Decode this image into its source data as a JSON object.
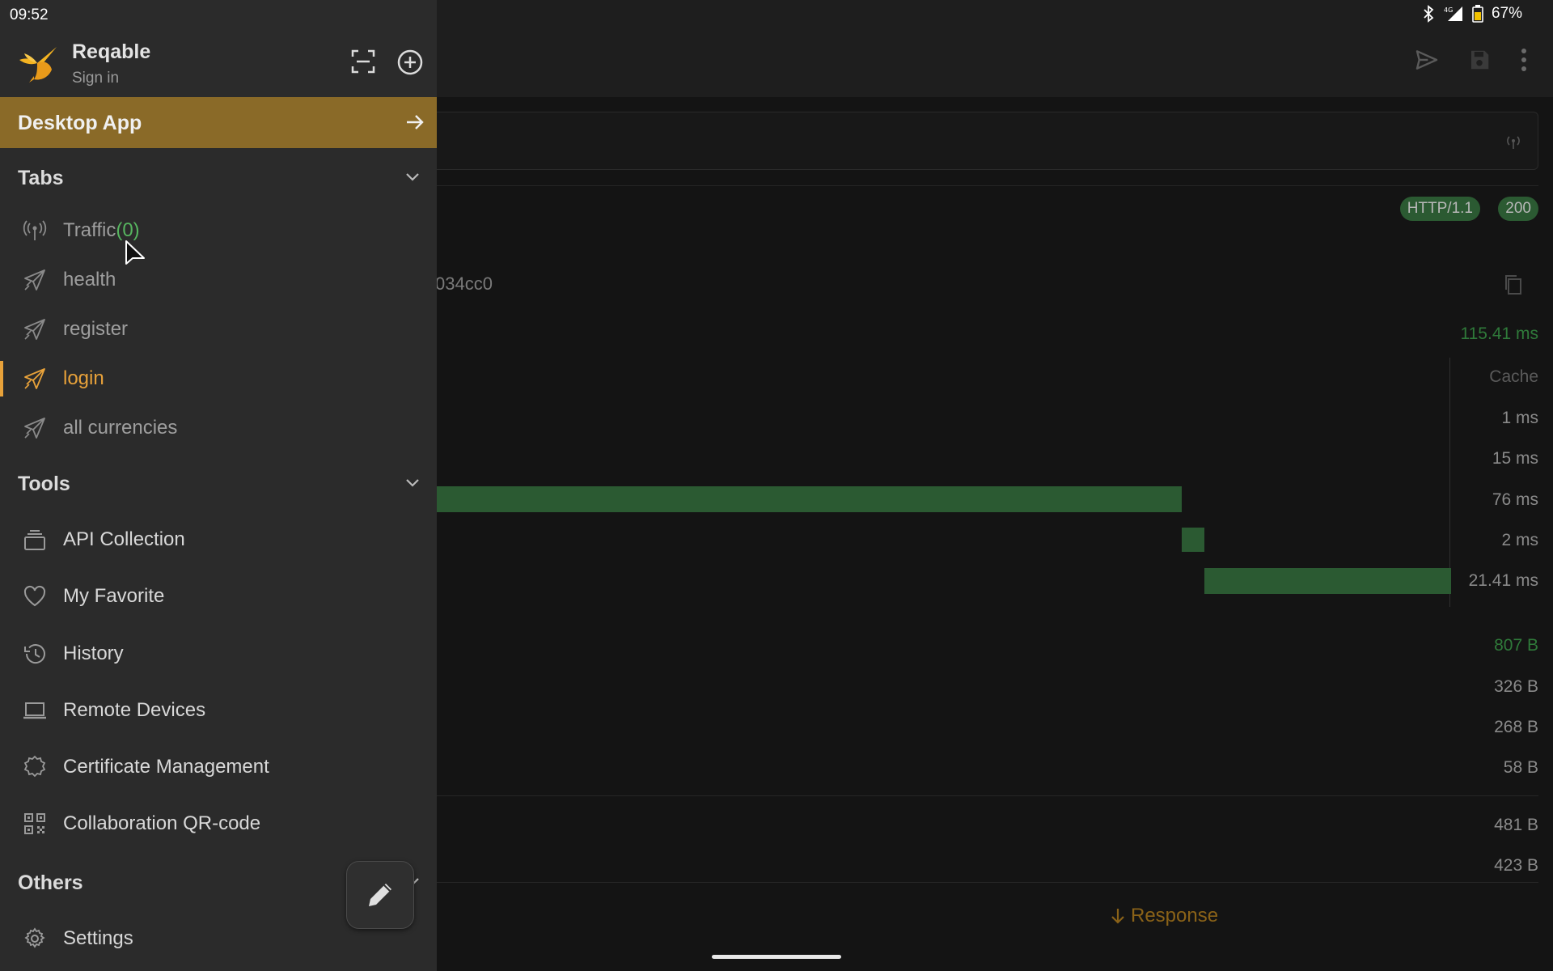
{
  "status_bar": {
    "time": "09:52",
    "battery": "67%",
    "network": "4G"
  },
  "drawer": {
    "app_name": "Reqable",
    "sign_in": "Sign in",
    "desktop_banner": "Desktop App",
    "tabs_section": {
      "title": "Tabs",
      "items": [
        {
          "label": "Traffic",
          "count": "(0)",
          "icon": "antenna-icon"
        },
        {
          "label": "health",
          "icon": "send-icon"
        },
        {
          "label": "register",
          "icon": "send-icon"
        },
        {
          "label": "login",
          "icon": "send-icon",
          "active": true
        },
        {
          "label": "all currencies",
          "icon": "send-icon"
        }
      ]
    },
    "tools_section": {
      "title": "Tools",
      "items": [
        {
          "label": "API Collection",
          "icon": "stack-icon"
        },
        {
          "label": "My Favorite",
          "icon": "heart-icon"
        },
        {
          "label": "History",
          "icon": "history-icon"
        },
        {
          "label": "Remote Devices",
          "icon": "laptop-icon"
        },
        {
          "label": "Certificate Management",
          "icon": "certificate-icon"
        },
        {
          "label": "Collaboration QR-code",
          "icon": "qr-code-icon"
        }
      ]
    },
    "others_section": {
      "title": "Others",
      "items": [
        {
          "label": "Settings",
          "icon": "gear-icon"
        }
      ]
    }
  },
  "background": {
    "protocol_chip": "HTTP/1.1",
    "status_chip": "200",
    "partial_id": "034cc0",
    "total_time": "115.41 ms",
    "timing_rows": [
      {
        "label": "Cache"
      },
      {
        "label": "1 ms"
      },
      {
        "label": "15 ms"
      },
      {
        "label": "76 ms"
      },
      {
        "label": "2 ms"
      },
      {
        "label": "21.41 ms"
      }
    ],
    "size_total": "807 B",
    "sizes": [
      "326 B",
      "268 B",
      "58 B"
    ],
    "sizes_lower": [
      "481 B",
      "423 B"
    ],
    "response_tab": "Response"
  },
  "colors": {
    "accent": "#e8a23a",
    "banner": "#8a6a28",
    "success": "#2b5a32"
  }
}
